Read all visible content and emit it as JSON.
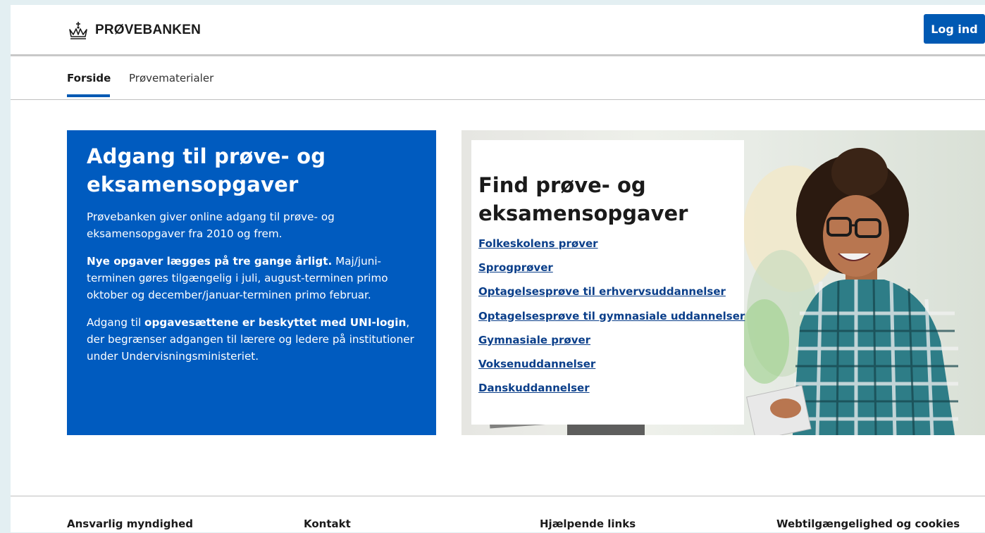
{
  "header": {
    "brand": "PRØVEBANKEN",
    "login_label": "Log ind"
  },
  "nav": {
    "items": [
      {
        "label": "Forside",
        "active": true
      },
      {
        "label": "Prøvematerialer",
        "active": false
      }
    ]
  },
  "info": {
    "title": "Adgang til prøve- og eksamensopgaver",
    "p1": "Prøvebanken giver online adgang til prøve- og eksamensopgaver fra 2010 og frem.",
    "p2_bold": "Nye opgaver lægges på tre gange årligt.",
    "p2_rest": " Maj/juni-terminen gøres tilgængelig i juli, august-terminen primo oktober og december/januar-terminen primo februar.",
    "p3_start": "Adgang til ",
    "p3_bold": "opgavesættene er beskyttet med UNI-login",
    "p3_rest": ", der begrænser adgangen til lærere og ledere på institutioner under Undervisningsministeriet."
  },
  "find": {
    "title": "Find prøve- og eksamensopgaver",
    "links": [
      "Folkeskolens prøver",
      "Sprogprøver",
      "Optagelsesprøve til erhvervsuddannelser",
      "Optagelsesprøve til gymnasiale uddannelser",
      "Gymnasiale prøver",
      "Voksenuddannelser",
      "Danskuddannelser"
    ]
  },
  "footer": {
    "headings": [
      "Ansvarlig myndighed",
      "Kontakt",
      "Hjælpende links",
      "Webtilgængelighed og cookies"
    ]
  },
  "colors": {
    "primary": "#0059b3",
    "info_box": "#005bbf",
    "link": "#0b3f8a",
    "page_bg": "#e3eff2"
  },
  "icons": {
    "logo": "crown-icon"
  }
}
